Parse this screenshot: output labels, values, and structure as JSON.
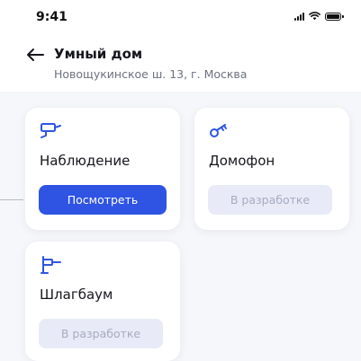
{
  "status_bar": {
    "time": "9:41"
  },
  "header": {
    "title": "Умный дом",
    "address": "Новощукинское ш. 13, г. Москва"
  },
  "cards": [
    {
      "title": "Наблюдение",
      "button_label": "Посмотреть",
      "icon": "camera-icon",
      "enabled": true
    },
    {
      "title": "Домофон",
      "button_label": "В разработке",
      "icon": "key-icon",
      "enabled": false
    },
    {
      "title": "Шлагбаум",
      "button_label": "В разработке",
      "icon": "barrier-icon",
      "enabled": false
    }
  ],
  "colors": {
    "accent": "#2f54e4",
    "disabled_bg": "#e8ebf7",
    "disabled_text": "#a6abc0",
    "content_bg": "#f6f7fa"
  }
}
